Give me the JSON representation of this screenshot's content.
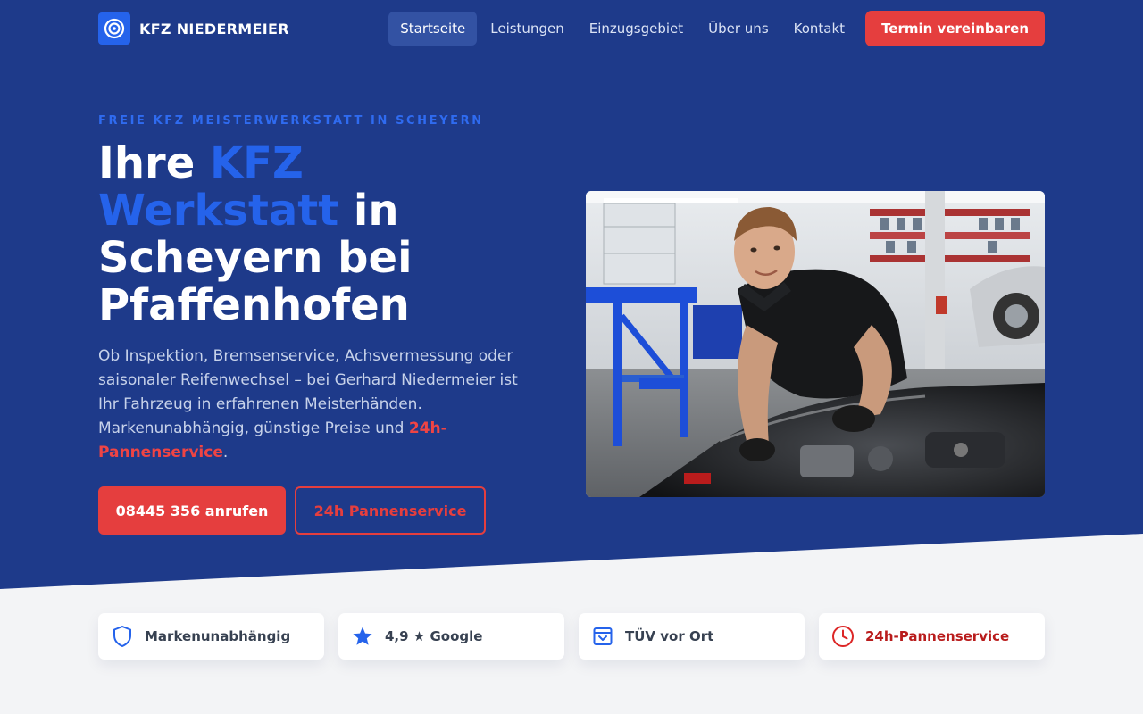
{
  "brand": {
    "name": "KFZ NIEDERMEIER"
  },
  "nav": {
    "items": [
      {
        "label": "Startseite",
        "active": true
      },
      {
        "label": "Leistungen"
      },
      {
        "label": "Einzugsgebiet"
      },
      {
        "label": "Über uns"
      },
      {
        "label": "Kontakt"
      }
    ],
    "cta_label": "Termin vereinbaren"
  },
  "hero": {
    "eyebrow": "FREIE KFZ MEISTERWERKSTATT IN SCHEYERN",
    "title_part1": "Ihre ",
    "title_accent": "KFZ Werkstatt",
    "title_part2": " in Scheyern bei Pfaffenhofen",
    "lead_text": "Ob Inspektion, Bremsenservice, Achsvermessung oder saisonaler Reifenwechsel – bei Gerhard Niedermeier ist Ihr Fahrzeug in erfahrenen Meisterhänden. Markenunabhängig, günstige Preise und ",
    "lead_highlight": "24h-Pannenservice",
    "lead_end": ".",
    "primary_button": "08445 356 anrufen",
    "secondary_button": "24h Pannenservice"
  },
  "features": [
    {
      "label": "Markenunabhängig",
      "icon": "shield-icon"
    },
    {
      "label": "4,9 ★ Google",
      "icon": "star-icon"
    },
    {
      "label": "TÜV vor Ort",
      "icon": "inspection-box-icon"
    },
    {
      "label": "24h-Pannenservice",
      "icon": "clock-icon"
    }
  ],
  "colors": {
    "hero_bg": "#1e3a8a",
    "accent_blue": "#2563eb",
    "accent_red": "#e53e3e",
    "page_bg": "#f3f4f6"
  }
}
